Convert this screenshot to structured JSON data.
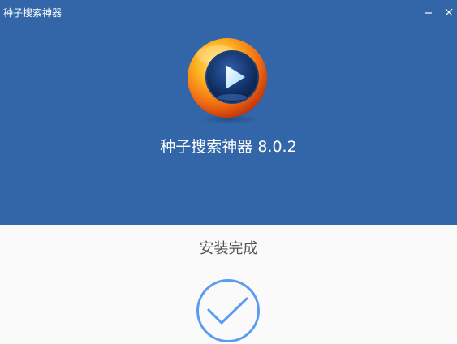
{
  "window": {
    "title": "种子搜索神器",
    "minimize_icon": "minimize-icon",
    "close_icon": "close-icon"
  },
  "app": {
    "name": "种子搜索神器",
    "version": "8.0.2",
    "logo_icon": "play-orb-logo"
  },
  "status": {
    "text": "安装完成",
    "icon": "checkmark-circle-icon"
  },
  "colors": {
    "header_bg": "#3266a8",
    "body_bg": "#fafafa",
    "check_blue": "#5b9bf0",
    "status_text": "#555555"
  }
}
